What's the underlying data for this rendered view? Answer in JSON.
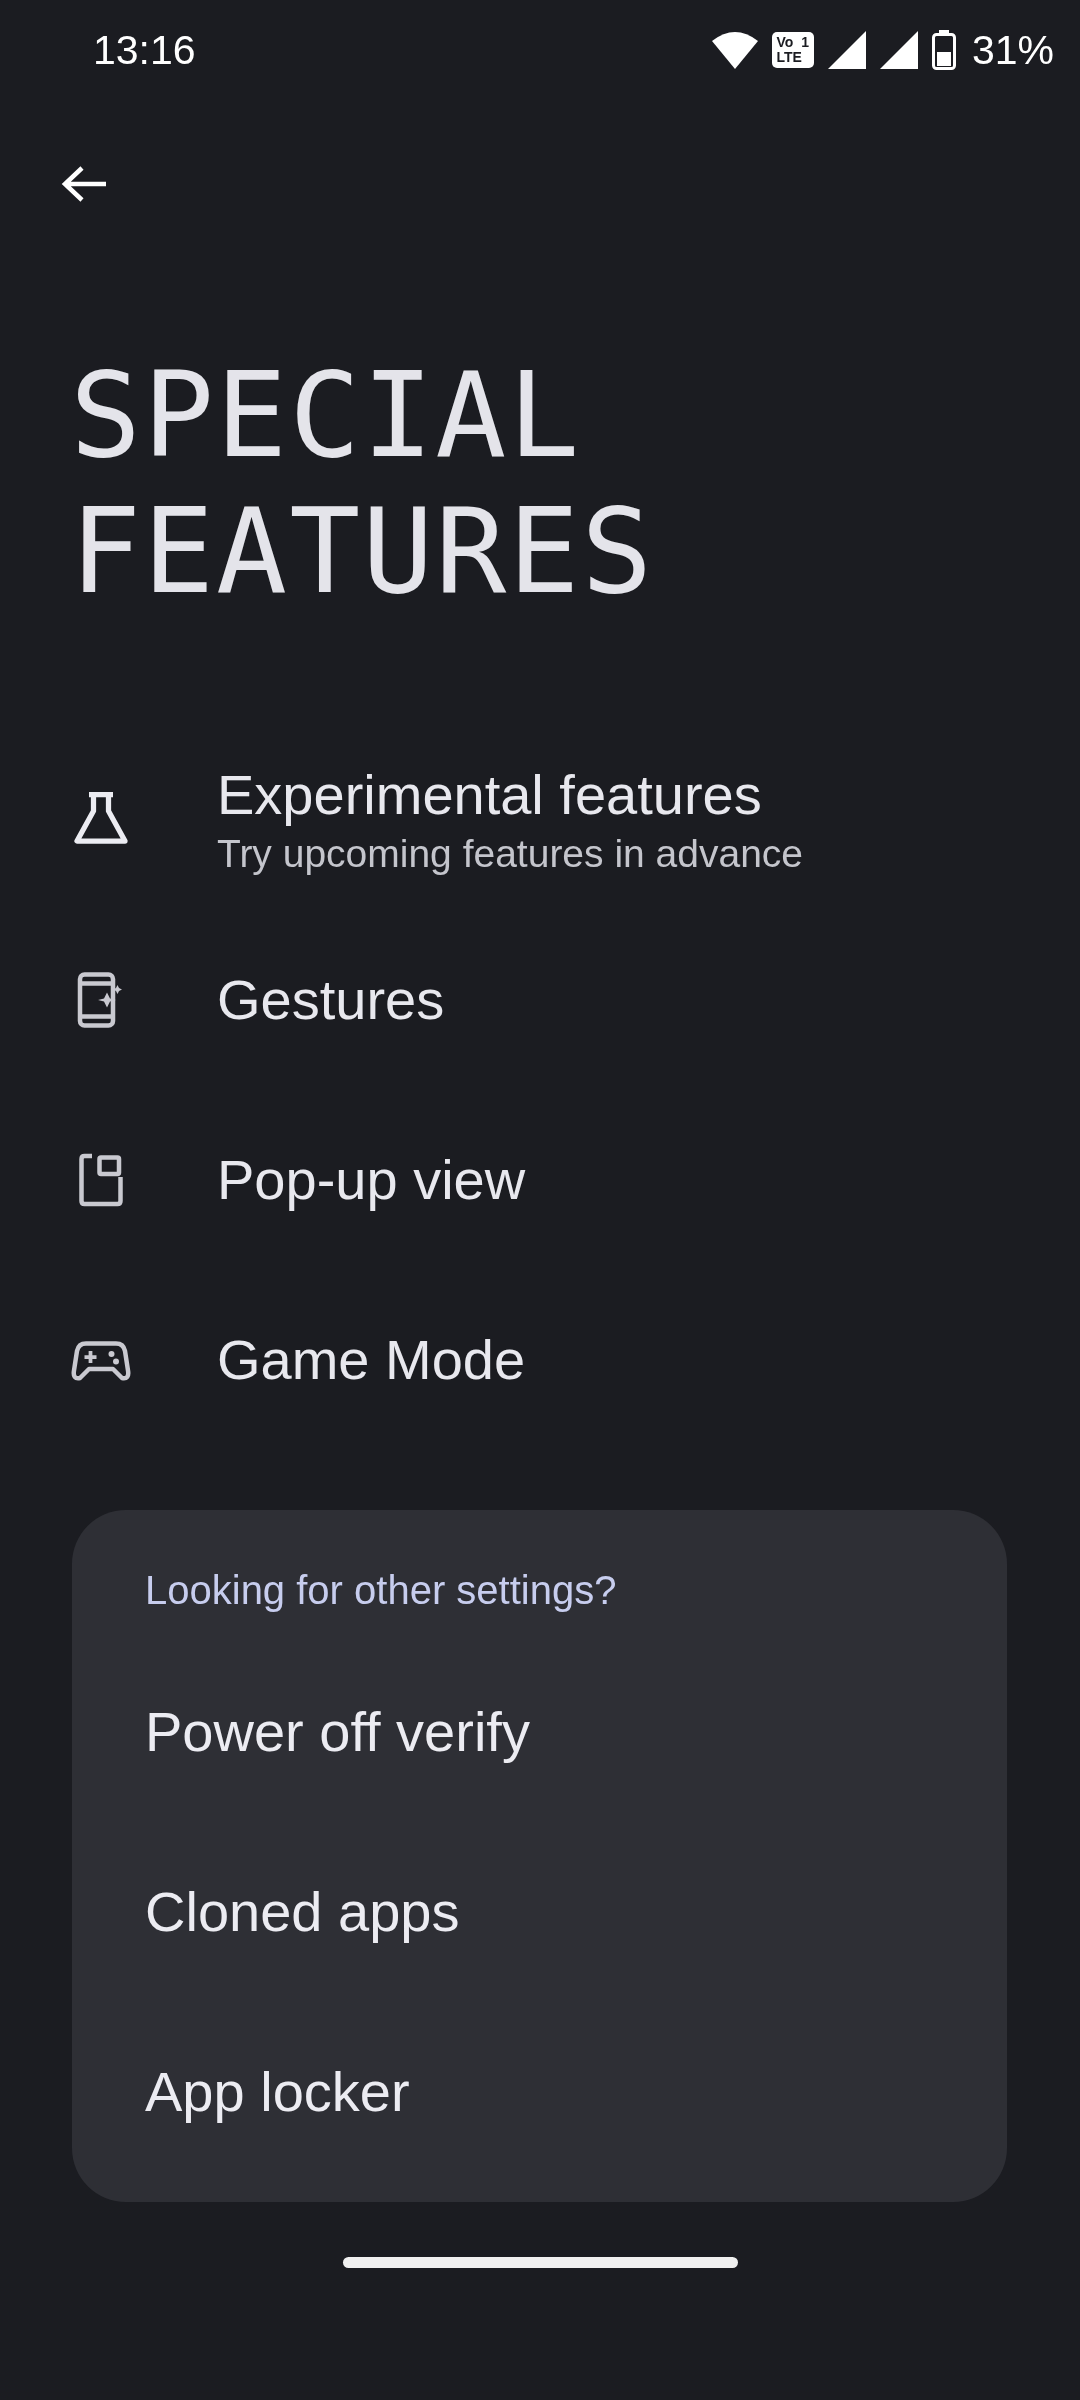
{
  "status_bar": {
    "time": "13:16",
    "volte_badge": "Vo  1\nLTE",
    "battery": "31%"
  },
  "title": [
    "SPECIAL",
    "FEATURES"
  ],
  "items": [
    {
      "kind": "flask",
      "title": "Experimental features",
      "subtitle": "Try upcoming features in advance"
    },
    {
      "kind": "gestures",
      "title": "Gestures"
    },
    {
      "kind": "popup",
      "title": "Pop-up view"
    },
    {
      "kind": "game",
      "title": "Game Mode"
    }
  ],
  "other_settings": {
    "heading": "Looking for other settings?",
    "items": [
      "Power off verify",
      "Cloned apps",
      "App locker"
    ]
  }
}
